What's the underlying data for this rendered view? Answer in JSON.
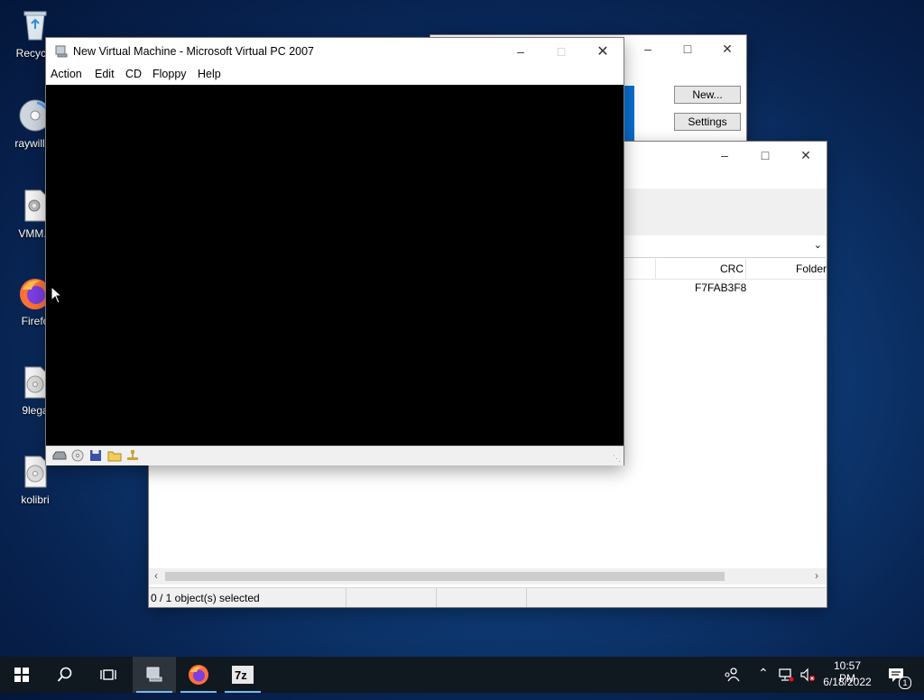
{
  "desktop": {
    "icons": [
      {
        "label": "Recycle",
        "icon": "recycle-bin-icon"
      },
      {
        "label": "raywilliai",
        "icon": "disc-icon"
      },
      {
        "label": "VMM.s",
        "icon": "settings-file-icon"
      },
      {
        "label": "Firefo",
        "icon": "firefox-icon"
      },
      {
        "label": "9lega",
        "icon": "disc-image-icon"
      },
      {
        "label": "kolibri",
        "icon": "disc-image-icon"
      }
    ]
  },
  "console_window": {
    "buttons": {
      "new": "New...",
      "settings": "Settings"
    }
  },
  "zip_window": {
    "columns": {
      "crc": "CRC",
      "folder": "Folder"
    },
    "row": {
      "crc": "F7FAB3F8"
    },
    "status": "0 / 1 object(s) selected"
  },
  "vpc_window": {
    "title": "New Virtual Machine - Microsoft Virtual PC 2007",
    "menu": [
      "Action",
      "Edit",
      "CD",
      "Floppy",
      "Help"
    ]
  },
  "taskbar": {
    "time": "10:57 PM",
    "date": "6/18/2022",
    "notification_count": "1"
  },
  "colors": {
    "accent": "#0078d7",
    "taskbar": "#101820"
  }
}
